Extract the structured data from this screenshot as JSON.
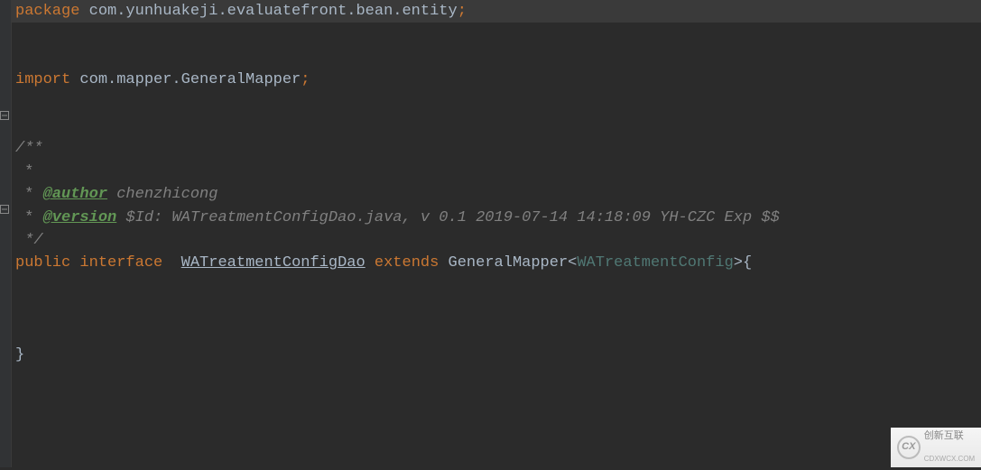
{
  "code": {
    "package_kw": "package",
    "package_path": " com.yunhuakeji.evaluatefront.bean.entity",
    "semicolon": ";",
    "import_kw": "import",
    "import_path": " com.mapper.GeneralMapper",
    "doc_open": "/**",
    "doc_star": " *",
    "doc_star2": " * ",
    "doc_author_tag": "@author",
    "doc_author_val": " chenzhicong",
    "doc_version_tag": "@version",
    "doc_version_val": " $Id: WATreatmentConfigDao.java, v 0.1 2019-07-14 14:18:09 YH-CZC Exp $$",
    "doc_close": " */",
    "public_kw": "public",
    "interface_kw": " interface",
    "iface_name": "WATreatmentConfigDao",
    "extends_kw": " extends",
    "parent_class": " GeneralMapper",
    "lt": "<",
    "type_param": "WATreatmentConfig",
    "gt": ">",
    "open_brace": "{",
    "close_brace": "}",
    "sp2": "  "
  },
  "watermark": {
    "logo_text": "CX",
    "brand_text": "创新互联",
    "url_text": "CDXWCX.COM"
  }
}
